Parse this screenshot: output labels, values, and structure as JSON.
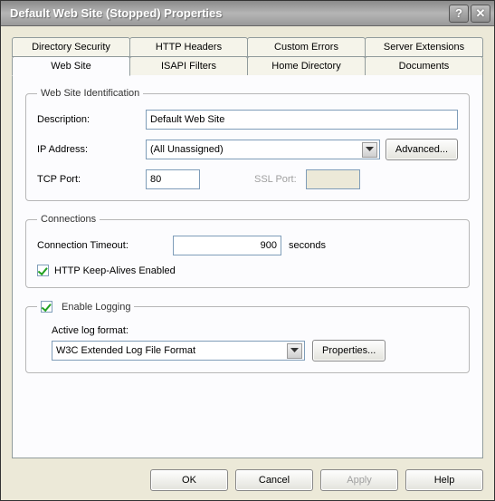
{
  "window": {
    "title": "Default Web Site (Stopped) Properties",
    "help_btn": "?",
    "close_btn": "✕"
  },
  "tabs_row1": {
    "t0": "Directory Security",
    "t1": "HTTP Headers",
    "t2": "Custom Errors",
    "t3": "Server Extensions"
  },
  "tabs_row2": {
    "t0": "Web Site",
    "t1": "ISAPI Filters",
    "t2": "Home Directory",
    "t3": "Documents"
  },
  "ident": {
    "legend": "Web Site Identification",
    "description_label": "Description:",
    "description_value": "Default Web Site",
    "ip_label": "IP Address:",
    "ip_value": "(All Unassigned)",
    "advanced_btn": "Advanced...",
    "tcp_label": "TCP Port:",
    "tcp_value": "80",
    "ssl_label": "SSL Port:",
    "ssl_value": ""
  },
  "conn": {
    "legend": "Connections",
    "timeout_label": "Connection Timeout:",
    "timeout_value": "900",
    "timeout_unit": "seconds",
    "keepalive_label": "HTTP Keep-Alives Enabled"
  },
  "logging": {
    "enable_label": "Enable Logging",
    "format_label": "Active log format:",
    "format_value": "W3C Extended Log File Format",
    "properties_btn": "Properties..."
  },
  "footer": {
    "ok": "OK",
    "cancel": "Cancel",
    "apply": "Apply",
    "help": "Help"
  }
}
